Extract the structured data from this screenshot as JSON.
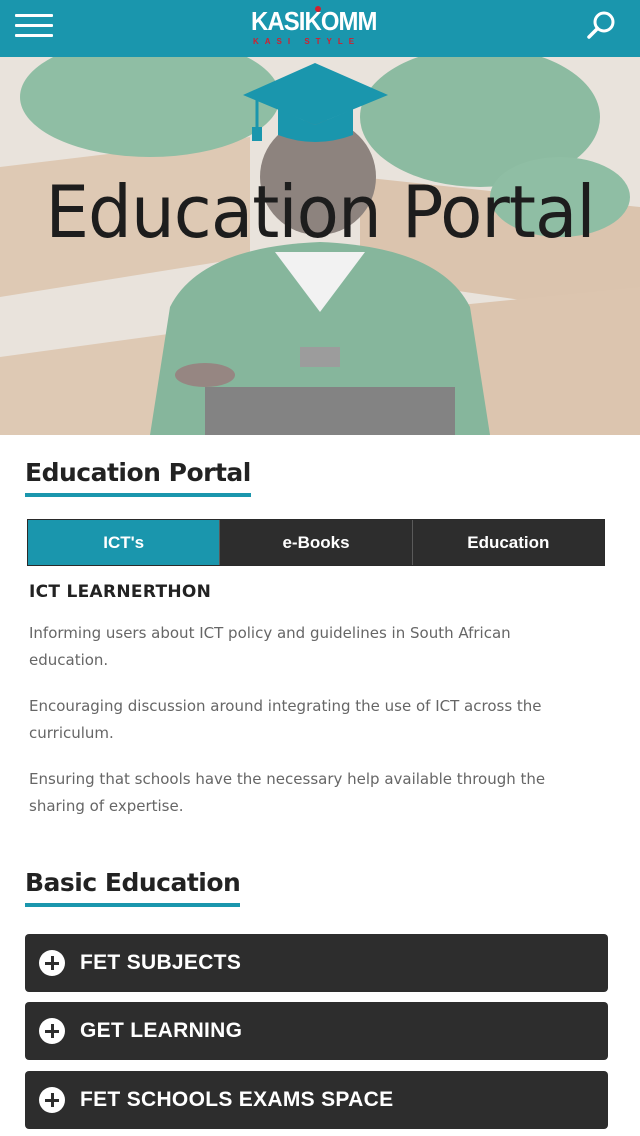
{
  "header": {
    "logo_text": "KASIKOMM",
    "logo_tagline": "KASI STYLE",
    "menu_icon": "hamburger-menu-icon",
    "search_icon": "search-icon",
    "bar_color": "#1a96ad"
  },
  "hero": {
    "title": "Education Portal",
    "icon": "graduation-cap-icon"
  },
  "portal_section": {
    "heading": "Education Portal",
    "tabs": [
      {
        "label": "ICT's",
        "active": true
      },
      {
        "label": "e-Books",
        "active": false
      },
      {
        "label": "Education",
        "active": false
      }
    ],
    "content": {
      "title": "ICT LEARNERTHON",
      "paragraphs": [
        "Informing users about ICT policy and guidelines in South African education.",
        "Encouraging discussion around integrating the use of ICT across the curriculum.",
        "Ensuring that schools have the necessary help available through the sharing of expertise."
      ]
    }
  },
  "basic_section": {
    "heading": "Basic Education",
    "accordions": [
      {
        "label": "FET SUBJECTS",
        "icon": "plus-icon"
      },
      {
        "label": "GET LEARNING",
        "icon": "plus-icon"
      },
      {
        "label": "FET SCHOOLS EXAMS SPACE",
        "icon": "plus-icon"
      }
    ]
  },
  "colors": {
    "accent": "#1a96ad",
    "dark_panel": "#2d2d2d",
    "logo_red": "#d11f2f"
  }
}
